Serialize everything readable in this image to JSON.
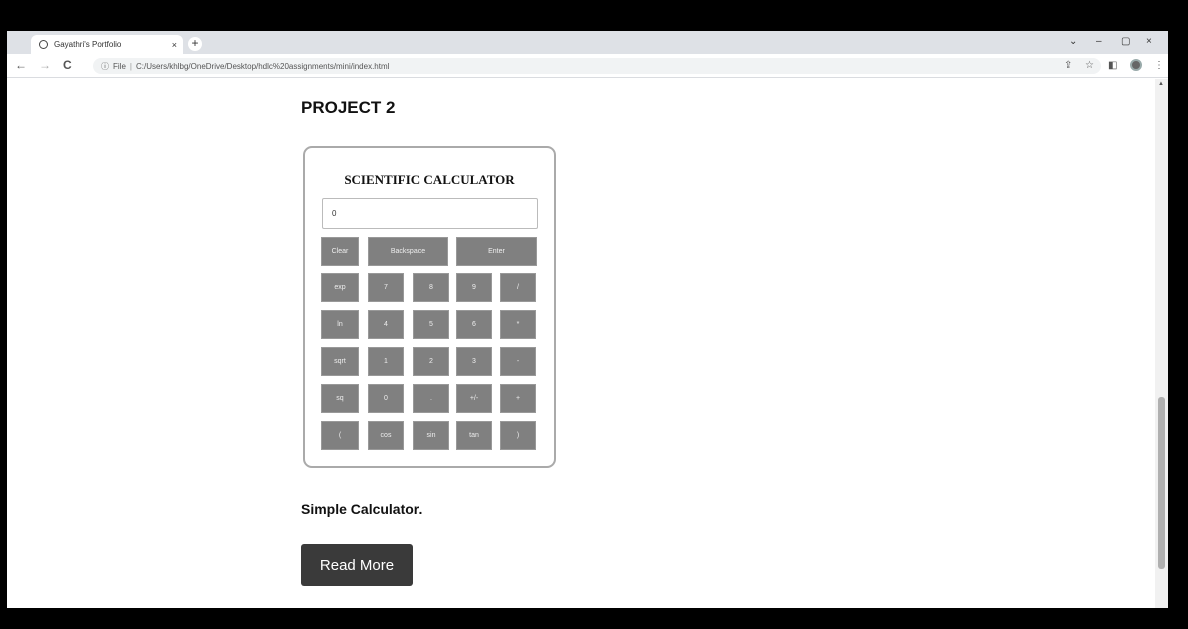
{
  "browser": {
    "tab_title": "Gayathri's Portfolio",
    "tab_close": "×",
    "new_tab": "+",
    "window_controls": {
      "dropdown": "⌄",
      "minimize": "–",
      "restore": "▢",
      "close": "×"
    },
    "nav": {
      "back": "←",
      "forward": "→",
      "reload": "C"
    },
    "address": {
      "scheme_label": "File",
      "separator": "|",
      "url": "C:/Users/khlbg/OneDrive/Desktop/hdlc%20assignments/mini/index.html"
    },
    "toolbar_icons": [
      "share-icon",
      "star-icon",
      "sidebar-icon",
      "profile-icon",
      "menu-icon"
    ]
  },
  "page": {
    "heading": "PROJECT 2",
    "calculator": {
      "title": "SCIENTIFIC CALCULATOR",
      "display_value": "0",
      "top_keys": [
        "Clear",
        "Backspace",
        "Enter"
      ],
      "rows": [
        [
          "exp",
          "7",
          "8",
          "9",
          "/"
        ],
        [
          "ln",
          "4",
          "5",
          "6",
          "*"
        ],
        [
          "sqrt",
          "1",
          "2",
          "3",
          "-"
        ],
        [
          "sq",
          "0",
          ".",
          "+/-",
          "+"
        ],
        [
          "(",
          "cos",
          "sin",
          "tan",
          ")"
        ]
      ]
    },
    "caption": "Simple Calculator.",
    "read_more": "Read More"
  },
  "colors": {
    "key_bg": "#808080",
    "button_bg": "#3a3a3a",
    "tab_strip": "#dee1e6"
  }
}
